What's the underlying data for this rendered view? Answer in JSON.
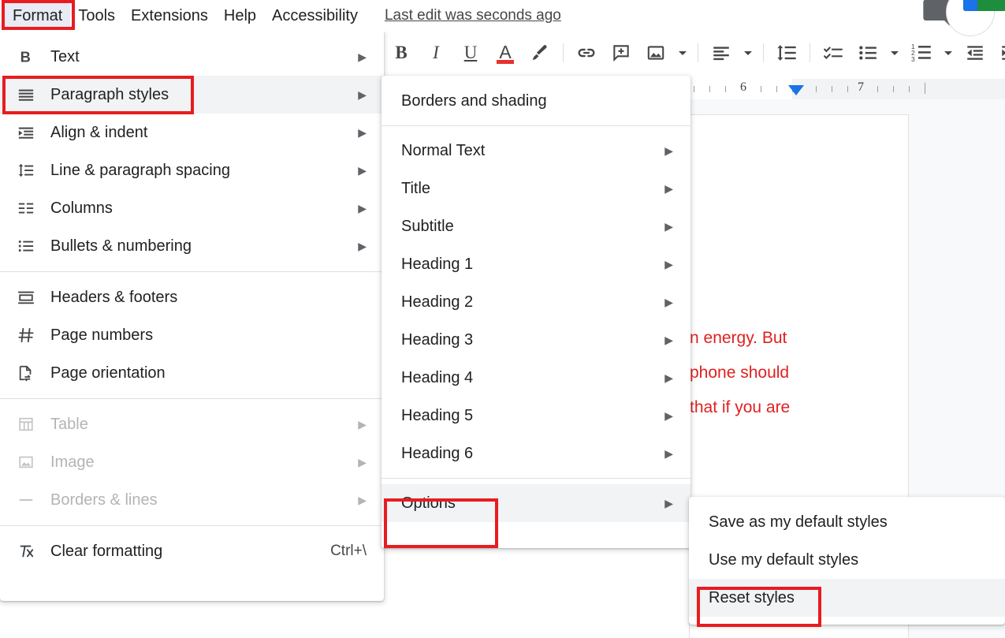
{
  "app": {
    "last_edit": "Last edit was seconds ago"
  },
  "menubar": {
    "items": [
      {
        "label": "Format",
        "active": true
      },
      {
        "label": "Tools",
        "active": false
      },
      {
        "label": "Extensions",
        "active": false
      },
      {
        "label": "Help",
        "active": false
      },
      {
        "label": "Accessibility",
        "active": false
      }
    ]
  },
  "toolbar": {
    "bold": "B",
    "italic": "I",
    "underline": "U",
    "text_color": "A",
    "text_color_swatch": "#e8312a",
    "highlight": "highlight-pen-icon",
    "link": "link-icon",
    "comment": "add-comment-icon",
    "image": "insert-image-icon",
    "image_dropdown": "chevron-down-icon",
    "align": "align-left-icon",
    "align_dropdown": "chevron-down-icon",
    "line_spacing": "line-spacing-icon",
    "checklist": "checklist-icon",
    "bulleted_list": "bulleted-list-icon",
    "bulleted_dropdown": "chevron-down-icon",
    "numbered_list": "numbered-list-icon",
    "numbered_dropdown": "chevron-down-icon",
    "decrease_indent": "decrease-indent-icon",
    "increase_indent": "increase-indent-icon"
  },
  "ruler": {
    "numbers": [
      "6",
      "7"
    ],
    "indent_marker": "left-indent-marker"
  },
  "document": {
    "lines": [
      "n energy. But",
      "phone should",
      "that if you are"
    ],
    "text_color": "#e02020"
  },
  "format_menu": {
    "items": [
      {
        "label": "Text",
        "icon": "bold-text-icon",
        "arrow": true,
        "disabled": false,
        "highlight": false,
        "shortcut": ""
      },
      {
        "label": "Paragraph styles",
        "icon": "paragraph-styles-icon",
        "arrow": true,
        "disabled": false,
        "highlight": true,
        "shortcut": ""
      },
      {
        "label": "Align & indent",
        "icon": "align-indent-icon",
        "arrow": true,
        "disabled": false,
        "highlight": false,
        "shortcut": ""
      },
      {
        "label": "Line & paragraph spacing",
        "icon": "line-spacing-icon",
        "arrow": true,
        "disabled": false,
        "highlight": false,
        "shortcut": ""
      },
      {
        "label": "Columns",
        "icon": "columns-icon",
        "arrow": true,
        "disabled": false,
        "highlight": false,
        "shortcut": ""
      },
      {
        "label": "Bullets & numbering",
        "icon": "bullets-numbering-icon",
        "arrow": true,
        "disabled": false,
        "highlight": false,
        "shortcut": ""
      },
      {
        "label": "Headers & footers",
        "icon": "headers-footers-icon",
        "arrow": false,
        "disabled": false,
        "highlight": false,
        "shortcut": ""
      },
      {
        "label": "Page numbers",
        "icon": "page-numbers-icon",
        "arrow": false,
        "disabled": false,
        "highlight": false,
        "shortcut": ""
      },
      {
        "label": "Page orientation",
        "icon": "page-orientation-icon",
        "arrow": false,
        "disabled": false,
        "highlight": false,
        "shortcut": ""
      },
      {
        "label": "Table",
        "icon": "table-icon",
        "arrow": true,
        "disabled": true,
        "highlight": false,
        "shortcut": ""
      },
      {
        "label": "Image",
        "icon": "image-icon",
        "arrow": true,
        "disabled": true,
        "highlight": false,
        "shortcut": ""
      },
      {
        "label": "Borders & lines",
        "icon": "borders-lines-icon",
        "arrow": true,
        "disabled": true,
        "highlight": false,
        "shortcut": ""
      },
      {
        "label": "Clear formatting",
        "icon": "clear-formatting-icon",
        "arrow": false,
        "disabled": false,
        "highlight": false,
        "shortcut": "Ctrl+\\"
      }
    ]
  },
  "paragraph_styles_menu": {
    "items": [
      {
        "label": "Borders and shading",
        "arrow": false,
        "highlight": false
      },
      {
        "label": "Normal Text",
        "arrow": true,
        "highlight": false
      },
      {
        "label": "Title",
        "arrow": true,
        "highlight": false
      },
      {
        "label": "Subtitle",
        "arrow": true,
        "highlight": false
      },
      {
        "label": "Heading 1",
        "arrow": true,
        "highlight": false
      },
      {
        "label": "Heading 2",
        "arrow": true,
        "highlight": false
      },
      {
        "label": "Heading 3",
        "arrow": true,
        "highlight": false
      },
      {
        "label": "Heading 4",
        "arrow": true,
        "highlight": false
      },
      {
        "label": "Heading 5",
        "arrow": true,
        "highlight": false
      },
      {
        "label": "Heading 6",
        "arrow": true,
        "highlight": false
      },
      {
        "label": "Options",
        "arrow": true,
        "highlight": true
      }
    ]
  },
  "options_menu": {
    "items": [
      {
        "label": "Save as my default styles",
        "highlight": false
      },
      {
        "label": "Use my default styles",
        "highlight": false
      },
      {
        "label": "Reset styles",
        "highlight": true
      }
    ]
  },
  "annotations": {
    "boxes": [
      {
        "name": "format-menu-highlight"
      },
      {
        "name": "paragraph-styles-highlight"
      },
      {
        "name": "options-highlight"
      },
      {
        "name": "reset-styles-highlight"
      }
    ],
    "color": "#e81c21"
  }
}
